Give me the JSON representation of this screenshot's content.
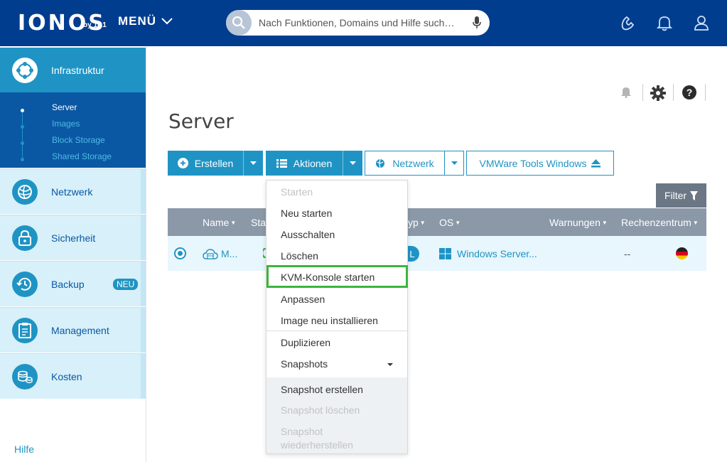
{
  "header": {
    "logo": "IONOS",
    "logo_by": "by 1&1",
    "menu_label": "MENÜ",
    "search_placeholder": "Nach Funktionen, Domains und Hilfe such…",
    "icons": [
      "phone-icon",
      "bell-icon",
      "user-icon"
    ]
  },
  "sidebar": {
    "active": {
      "label": "Infrastruktur",
      "icon": "infrastructure-icon"
    },
    "sub_items": [
      {
        "label": "Server",
        "active": true
      },
      {
        "label": "Images",
        "active": false
      },
      {
        "label": "Block Storage",
        "active": false
      },
      {
        "label": "Shared Storage",
        "active": false
      }
    ],
    "items": [
      {
        "label": "Netzwerk",
        "icon": "globe-icon"
      },
      {
        "label": "Sicherheit",
        "icon": "lock-icon"
      },
      {
        "label": "Backup",
        "icon": "backup-clock-icon",
        "badge": "NEU"
      },
      {
        "label": "Management",
        "icon": "clipboard-icon"
      },
      {
        "label": "Kosten",
        "icon": "coins-icon"
      }
    ],
    "help": "Hilfe"
  },
  "toolbar_icons": [
    "notification-bell-icon",
    "settings-gear-icon",
    "help-question-icon"
  ],
  "main": {
    "title": "Server",
    "buttons": {
      "create": "Erstellen",
      "actions": "Aktionen",
      "network": "Netzwerk",
      "vmware": "VMWare Tools Windows",
      "filter": "Filter"
    },
    "table": {
      "headers": {
        "name": "Name",
        "status": "Sta",
        "type": "yp",
        "os": "OS",
        "warnings": "Warnungen",
        "datacenter": "Rechenzentrum"
      },
      "row": {
        "name": "M...",
        "type_badge": "L",
        "os": "Windows Server...",
        "warnings": "--",
        "datacenter_flag": "de-flag"
      }
    }
  },
  "dropdown": {
    "items": [
      {
        "label": "Starten",
        "disabled": true
      },
      {
        "label": "Neu starten",
        "disabled": false
      },
      {
        "label": "Ausschalten",
        "disabled": false
      },
      {
        "label": "Löschen",
        "disabled": false
      },
      {
        "label": "KVM-Konsole starten",
        "disabled": false,
        "highlighted": true
      },
      {
        "label": "Anpassen",
        "disabled": false
      },
      {
        "label": "Image neu installieren",
        "disabled": false
      },
      {
        "label": "Duplizieren",
        "disabled": false
      },
      {
        "label": "Snapshots",
        "disabled": false
      },
      {
        "label": "Snapshot erstellen",
        "disabled": false
      },
      {
        "label": "Snapshot löschen",
        "disabled": true
      },
      {
        "label": "Snapshot wiederherstellen",
        "disabled": true
      }
    ]
  },
  "colors": {
    "header_bg": "#003d8f",
    "accent": "#1f94c4",
    "sidebar_sub_bg": "#0a58a3",
    "sidebar_item_bg": "#d7f0fa",
    "table_header_bg": "#8b98a8",
    "highlight_border": "#3cb53c"
  }
}
